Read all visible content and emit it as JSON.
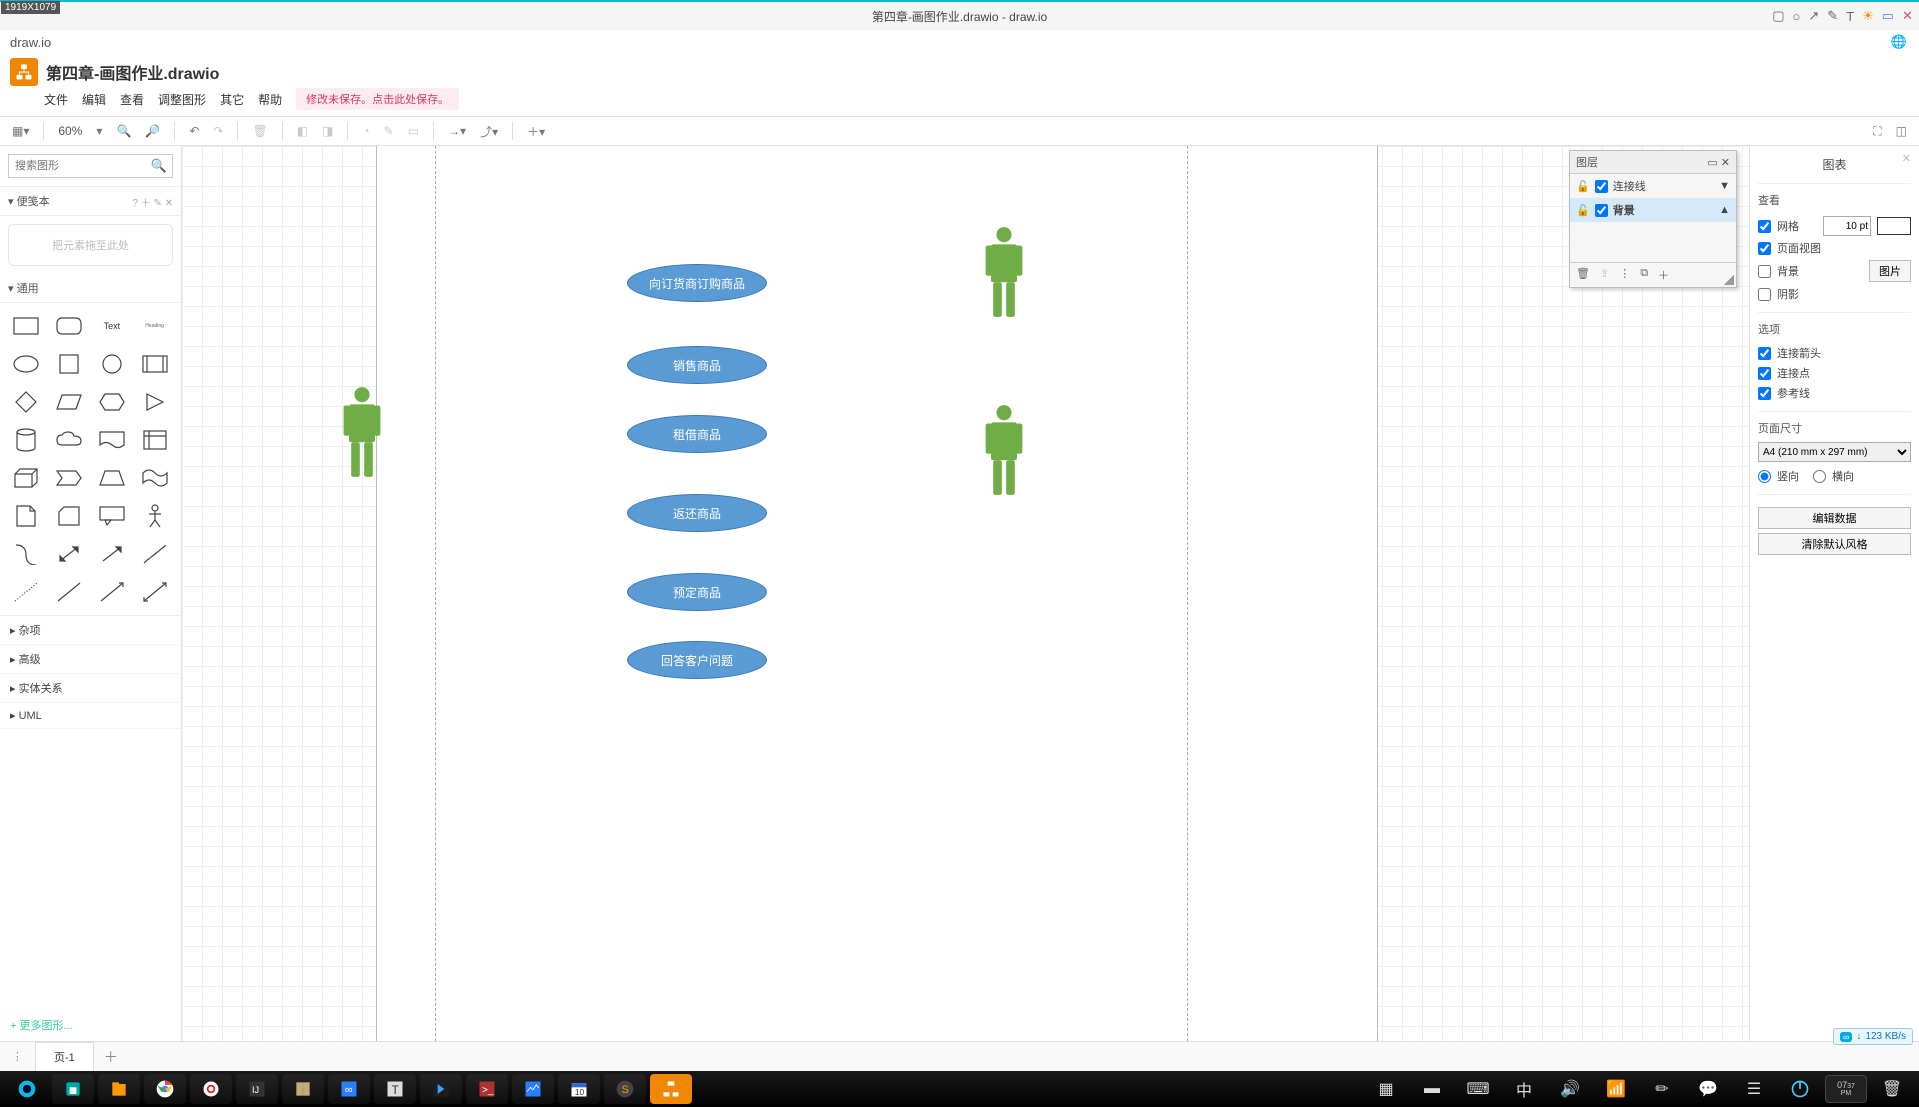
{
  "dim_badge": "1919X1079",
  "window_title": "第四章-画图作业.drawio - draw.io",
  "app_name": "draw.io",
  "filename": "第四章-画图作业.drawio",
  "menu": {
    "file": "文件",
    "edit": "编辑",
    "view": "查看",
    "arrange": "调整图形",
    "extras": "其它",
    "help": "帮助"
  },
  "unsaved_msg": "修改未保存。点击此处保存。",
  "toolbar": {
    "zoom": "60%"
  },
  "search": {
    "placeholder": "搜索图形"
  },
  "scratch": {
    "title": "便笺本",
    "hint": "把元素拖至此处"
  },
  "cat": {
    "general": "通用",
    "misc": "杂项",
    "advanced": "高级",
    "entity": "实体关系",
    "uml": "UML",
    "more": "更多图形..."
  },
  "usecases": {
    "uc1": "向订货商订购商品",
    "uc2": "销售商品",
    "uc3": "租借商品",
    "uc4": "返还商品",
    "uc5": "预定商品",
    "uc6": "回答客户问题"
  },
  "layers": {
    "title": "图层",
    "l1": "连接线",
    "l2": "背景"
  },
  "right": {
    "title": "图表",
    "view": "查看",
    "grid": "网格",
    "grid_val": "10 pt",
    "pageview": "页面视图",
    "background": "背景",
    "image_btn": "图片",
    "shadow": "阴影",
    "options": "选项",
    "conn_arrow": "连接箭头",
    "conn_point": "连接点",
    "guides": "参考线",
    "pagesize": "页面尺寸",
    "pagesize_val": "A4 (210 mm x 297 mm)",
    "portrait": "竖向",
    "landscape": "横向",
    "edit_data": "编辑数据",
    "clear_style": "清除默认风格"
  },
  "page_tab": "页-1",
  "net_speed": "123 KB/s",
  "clock": {
    "h": "07",
    "m": "37",
    "ap": "PM"
  },
  "shape_text": "Text",
  "shape_heading": "Heading"
}
